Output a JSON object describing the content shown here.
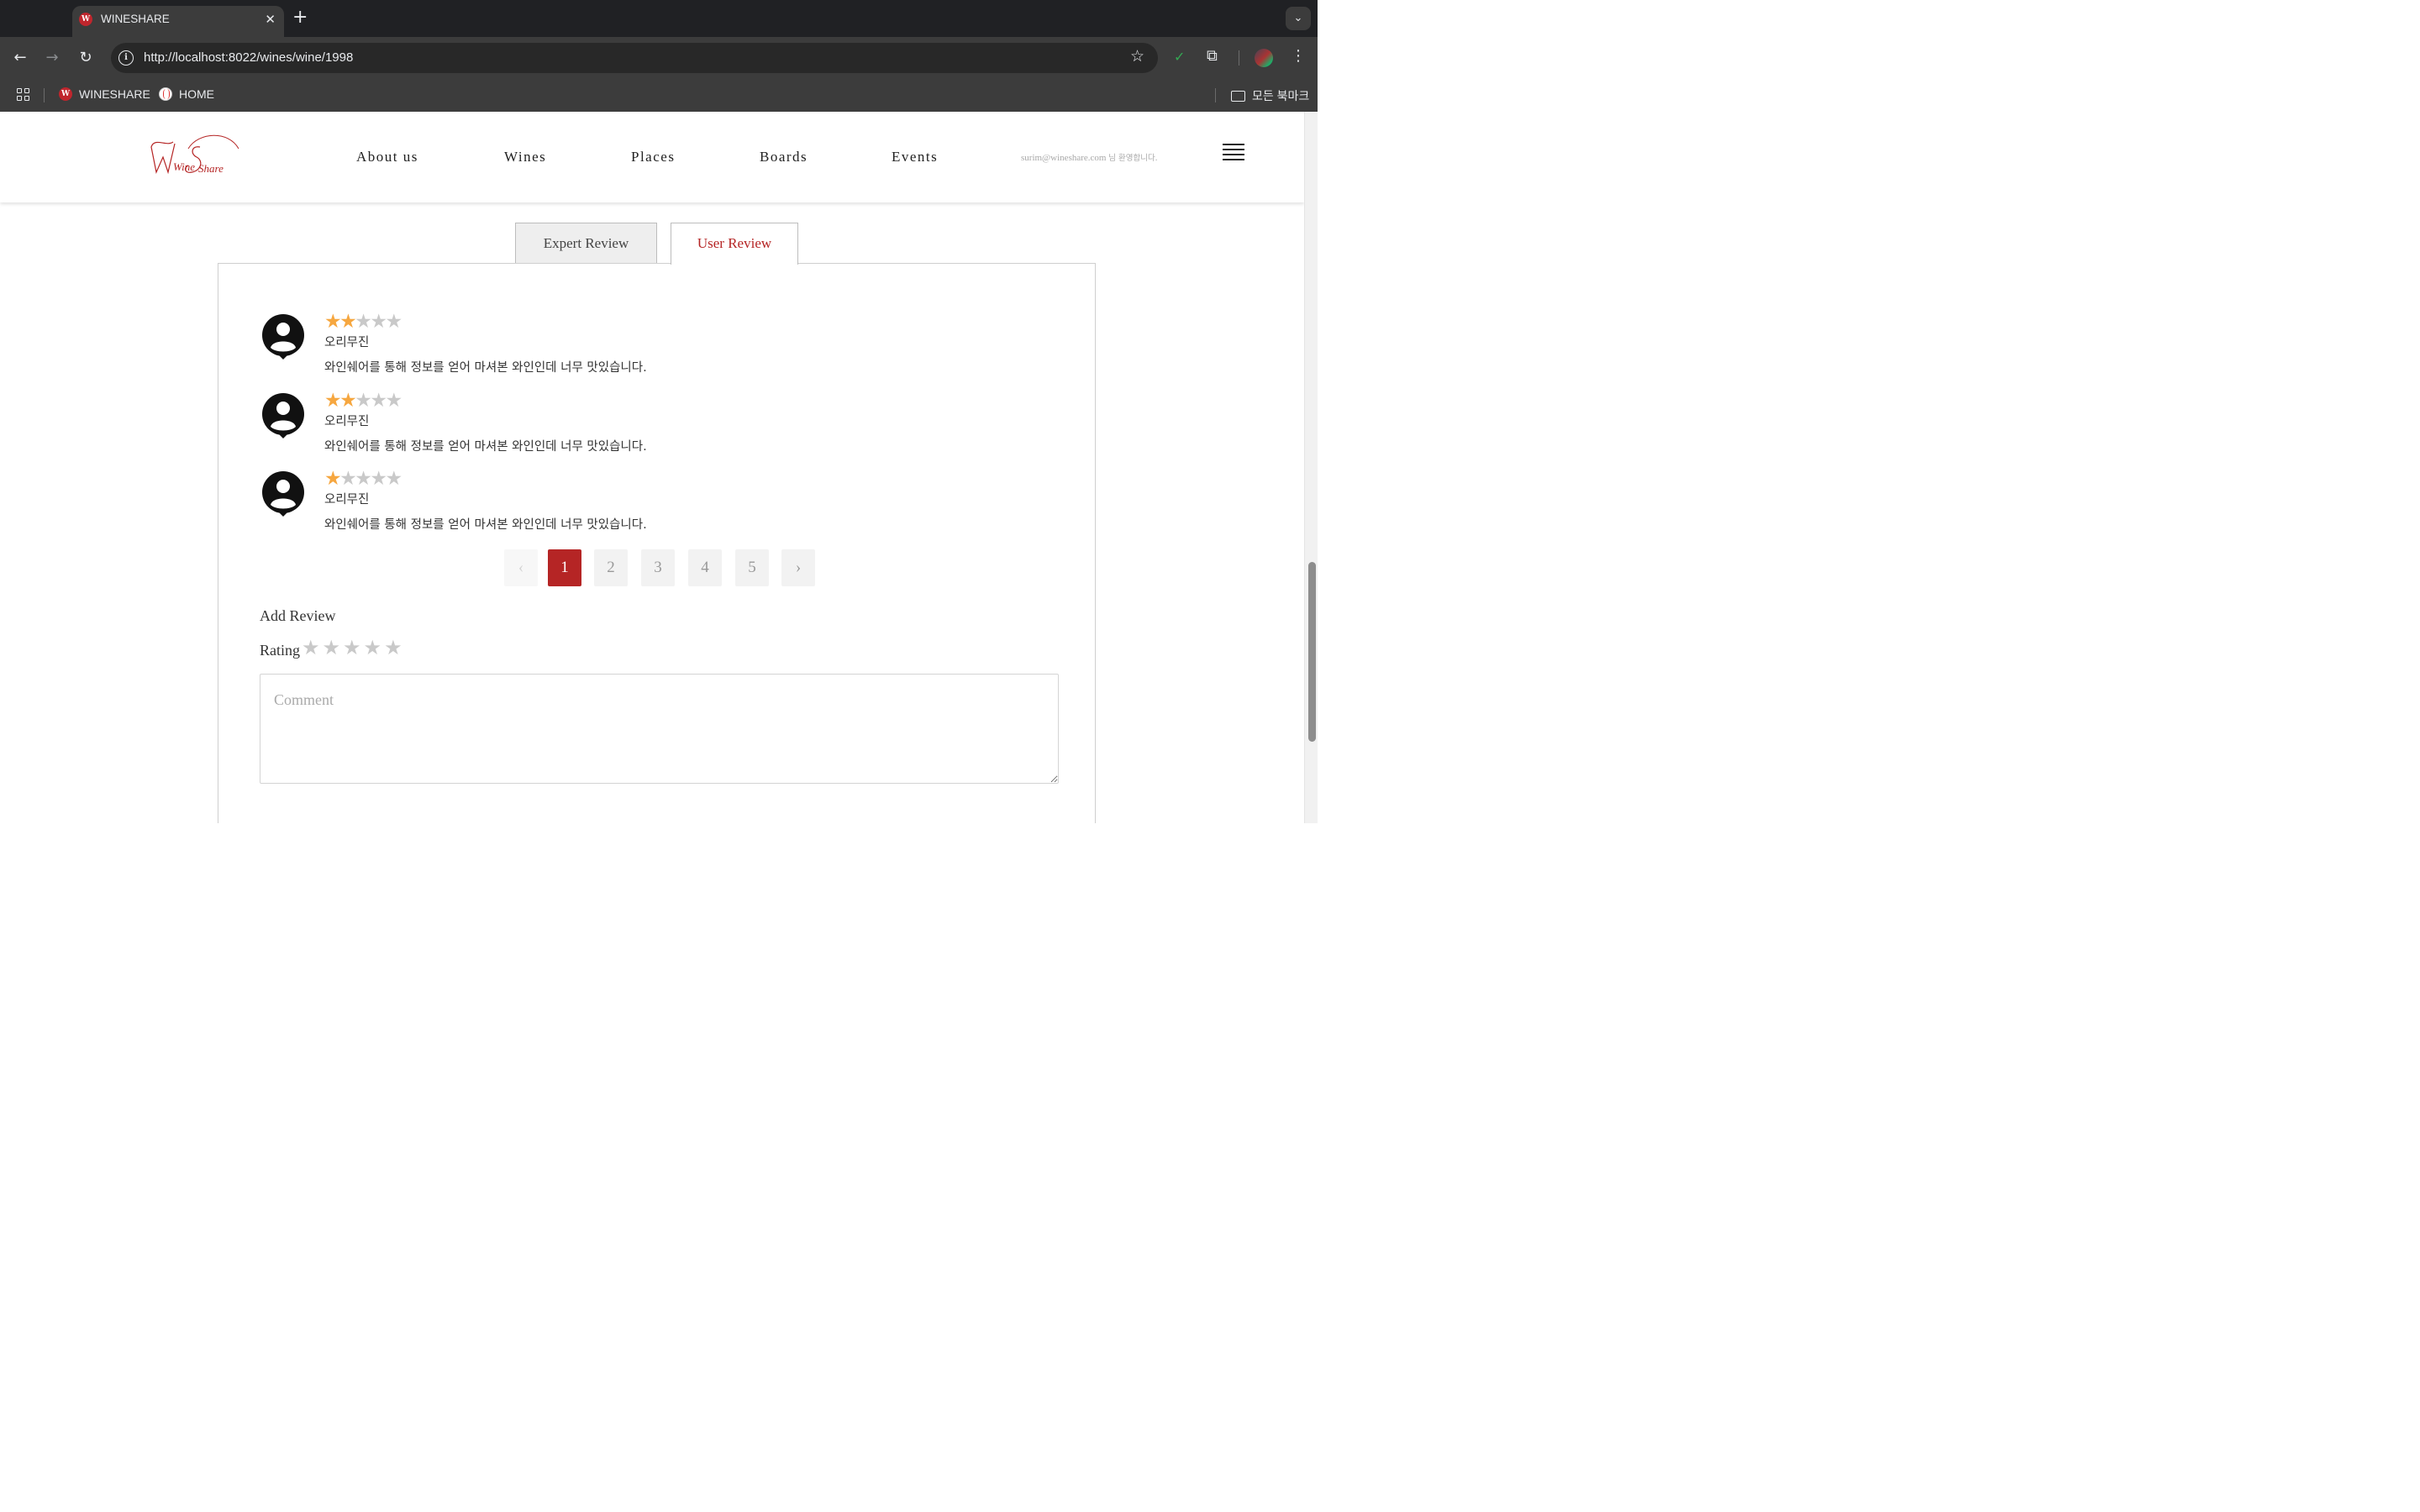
{
  "browser": {
    "tab_title": "WINESHARE",
    "tab_favicon": "W",
    "url": "http://localhost:8022/wines/wine/1998",
    "bookmarks": [
      {
        "label": "WINESHARE",
        "icon": "wineshare-favicon"
      },
      {
        "label": "HOME",
        "icon": "baseball-icon"
      }
    ],
    "all_bookmarks_label": "모든 북마크"
  },
  "site": {
    "logo_text_1": "Wine",
    "logo_text_2": "Share",
    "nav": [
      "About us",
      "Wines",
      "Places",
      "Boards",
      "Events"
    ],
    "welcome_email": "surim@wineshare.com",
    "welcome_suffix": "님 환영합니다."
  },
  "tabs": {
    "expert": "Expert Review",
    "user": "User Review",
    "active": "User Review"
  },
  "reviews": [
    {
      "rating": 2,
      "author": "오리무진",
      "text": "와인쉐어를 통해 정보를 얻어 마셔본 와인인데 너무 맛있습니다."
    },
    {
      "rating": 2,
      "author": "오리무진",
      "text": "와인쉐어를 통해 정보를 얻어 마셔본 와인인데 너무 맛있습니다."
    },
    {
      "rating": 1,
      "author": "오리무진",
      "text": "와인쉐어를 통해 정보를 얻어 마셔본 와인인데 너무 맛있습니다."
    }
  ],
  "pagination": {
    "prev": "‹",
    "next": "›",
    "pages": [
      "1",
      "2",
      "3",
      "4",
      "5"
    ],
    "current": "1"
  },
  "add_review": {
    "title": "Add Review",
    "rating_label": "Rating",
    "rating_value": 0,
    "max_rating": 5,
    "comment_placeholder": "Comment"
  },
  "colors": {
    "accent": "#b52525",
    "star_on": "#f6a740",
    "star_off": "#c9c9c9"
  }
}
